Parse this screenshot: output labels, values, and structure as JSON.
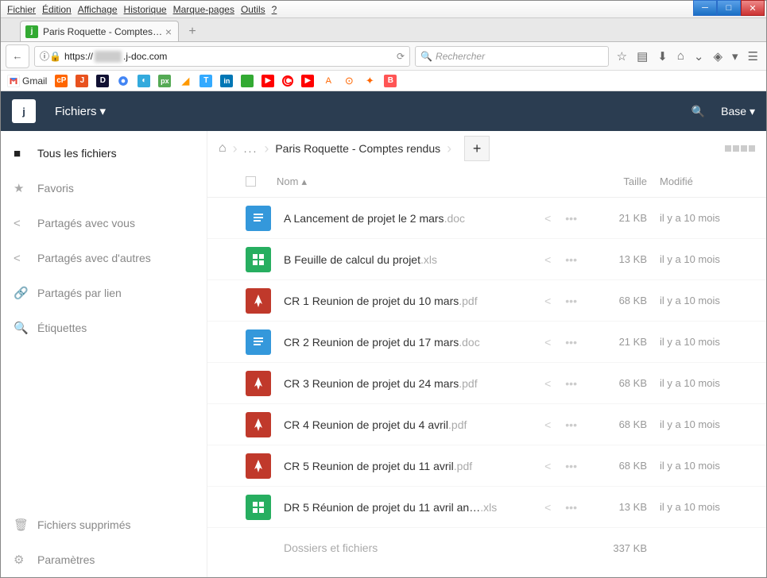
{
  "menu": [
    "Fichier",
    "Édition",
    "Affichage",
    "Historique",
    "Marque-pages",
    "Outils",
    "?"
  ],
  "tab": {
    "title": "Paris Roquette - Comptes r…"
  },
  "url": {
    "scheme": "https://",
    "domain": ".j-doc.com"
  },
  "search_placeholder": "Rechercher",
  "bookmarks_gmail": "Gmail",
  "app": {
    "nav": "Fichiers",
    "right_label": "Base"
  },
  "sidebar": [
    {
      "label": "Tous les fichiers",
      "icon": "folder",
      "active": true
    },
    {
      "label": "Favoris",
      "icon": "star"
    },
    {
      "label": "Partagés avec vous",
      "icon": "share"
    },
    {
      "label": "Partagés avec d'autres",
      "icon": "share"
    },
    {
      "label": "Partagés par lien",
      "icon": "link"
    },
    {
      "label": "Étiquettes",
      "icon": "tag"
    }
  ],
  "sidebar_bottom": [
    {
      "label": "Fichiers supprimés",
      "icon": "trash"
    },
    {
      "label": "Paramètres",
      "icon": "gear"
    }
  ],
  "breadcrumb": {
    "dots": "...",
    "current": "Paris Roquette - Comptes rendus"
  },
  "columns": {
    "name": "Nom",
    "size": "Taille",
    "modified": "Modifié"
  },
  "files": [
    {
      "name": "A Lancement de projet le 2 mars",
      "ext": ".doc",
      "type": "doc",
      "size": "21 KB",
      "modified": "il y a 10 mois"
    },
    {
      "name": "B Feuille de calcul du projet",
      "ext": ".xls",
      "type": "xls",
      "size": "13 KB",
      "modified": "il y a 10 mois"
    },
    {
      "name": "CR 1 Reunion de projet du 10 mars",
      "ext": ".pdf",
      "type": "pdf",
      "size": "68 KB",
      "modified": "il y a 10 mois"
    },
    {
      "name": "CR 2 Reunion de projet du 17 mars",
      "ext": ".doc",
      "type": "doc",
      "size": "21 KB",
      "modified": "il y a 10 mois"
    },
    {
      "name": "CR 3 Reunion de projet du 24 mars",
      "ext": ".pdf",
      "type": "pdf",
      "size": "68 KB",
      "modified": "il y a 10 mois"
    },
    {
      "name": "CR 4 Reunion de projet du 4 avril",
      "ext": ".pdf",
      "type": "pdf",
      "size": "68 KB",
      "modified": "il y a 10 mois"
    },
    {
      "name": "CR 5 Reunion de projet du 11 avril",
      "ext": ".pdf",
      "type": "pdf",
      "size": "68 KB",
      "modified": "il y a 10 mois"
    },
    {
      "name": "DR 5 Réunion de projet du 11 avril an…",
      "ext": ".xls",
      "type": "xls",
      "size": "13 KB",
      "modified": "il y a 10 mois"
    }
  ],
  "summary": {
    "label": "Dossiers et fichiers",
    "total": "337 KB"
  }
}
